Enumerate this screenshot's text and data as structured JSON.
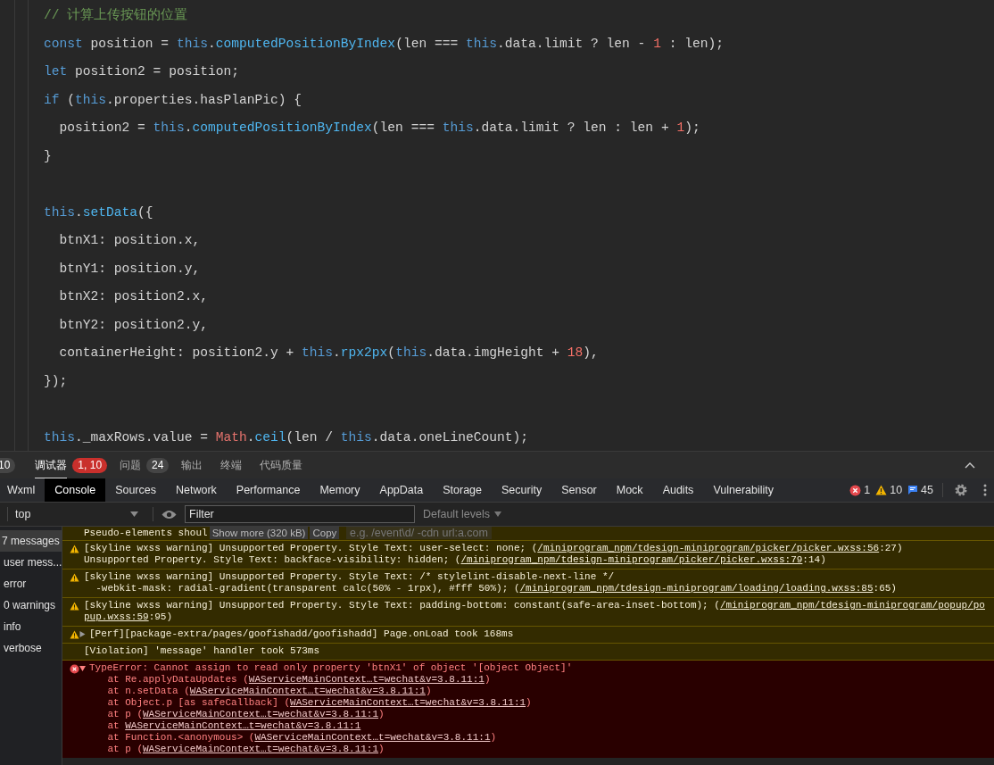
{
  "editor": {
    "lines": [
      {
        "kind": "code",
        "tokens": [
          {
            "t": "// 计算上传按钮的位置",
            "color": "#6a9955"
          }
        ]
      },
      {
        "kind": "code",
        "tokens": [
          {
            "t": "const",
            "color": "#569cd6"
          },
          {
            "t": " position = "
          },
          {
            "t": "this",
            "color": "#569cd6"
          },
          {
            "t": "."
          },
          {
            "t": "computedPositionByIndex",
            "color": "#4fb6f0"
          },
          {
            "t": "(len === "
          },
          {
            "t": "this",
            "color": "#569cd6"
          },
          {
            "t": ".data.limit ? len - "
          },
          {
            "t": "1",
            "color": "#f47067"
          },
          {
            "t": " : len);"
          }
        ]
      },
      {
        "kind": "code",
        "tokens": [
          {
            "t": "let",
            "color": "#569cd6"
          },
          {
            "t": " position2 = position;"
          }
        ]
      },
      {
        "kind": "code",
        "tokens": [
          {
            "t": "if",
            "color": "#569cd6"
          },
          {
            "t": " ("
          },
          {
            "t": "this",
            "color": "#569cd6"
          },
          {
            "t": ".properties.hasPlanPic) {"
          }
        ]
      },
      {
        "kind": "code",
        "tokens": [
          {
            "t": "  position2 = "
          },
          {
            "t": "this",
            "color": "#569cd6"
          },
          {
            "t": "."
          },
          {
            "t": "computedPositionByIndex",
            "color": "#4fb6f0"
          },
          {
            "t": "(len === "
          },
          {
            "t": "this",
            "color": "#569cd6"
          },
          {
            "t": ".data.limit ? len : len + "
          },
          {
            "t": "1",
            "color": "#f47067"
          },
          {
            "t": ");"
          }
        ]
      },
      {
        "kind": "code",
        "tokens": [
          {
            "t": "}"
          }
        ]
      },
      {
        "kind": "blank"
      },
      {
        "kind": "code",
        "tokens": [
          {
            "t": "this",
            "color": "#569cd6"
          },
          {
            "t": "."
          },
          {
            "t": "setData",
            "color": "#4fb6f0"
          },
          {
            "t": "({"
          }
        ]
      },
      {
        "kind": "code",
        "tokens": [
          {
            "t": "  btnX1: position.x,"
          }
        ]
      },
      {
        "kind": "code",
        "tokens": [
          {
            "t": "  btnY1: position.y,"
          }
        ]
      },
      {
        "kind": "code",
        "tokens": [
          {
            "t": "  btnX2: position2.x,"
          }
        ]
      },
      {
        "kind": "code",
        "tokens": [
          {
            "t": "  btnY2: position2.y,"
          }
        ]
      },
      {
        "kind": "code",
        "tokens": [
          {
            "t": "  containerHeight: position2.y + "
          },
          {
            "t": "this",
            "color": "#569cd6"
          },
          {
            "t": "."
          },
          {
            "t": "rpx2px",
            "color": "#4fb6f0"
          },
          {
            "t": "("
          },
          {
            "t": "this",
            "color": "#569cd6"
          },
          {
            "t": ".data.imgHeight + "
          },
          {
            "t": "18",
            "color": "#f47067"
          },
          {
            "t": "),"
          }
        ]
      },
      {
        "kind": "code",
        "tokens": [
          {
            "t": "});"
          }
        ]
      },
      {
        "kind": "blank"
      },
      {
        "kind": "code",
        "tokens": [
          {
            "t": "this",
            "color": "#569cd6"
          },
          {
            "t": "._maxRows.value = "
          },
          {
            "t": "Math",
            "color": "#e5736d"
          },
          {
            "t": "."
          },
          {
            "t": "ceil",
            "color": "#4fb6f0"
          },
          {
            "t": "(len / "
          },
          {
            "t": "this",
            "color": "#569cd6"
          },
          {
            "t": ".data.oneLineCount);"
          }
        ]
      }
    ]
  },
  "panel": {
    "cut_badge": "10",
    "tabs": [
      {
        "label": "调试器",
        "badge": {
          "text": "1, 10",
          "color": "#c9302c"
        },
        "selected": true
      },
      {
        "label": "问题",
        "badge": {
          "text": "24",
          "color": "#454545"
        },
        "selected": false
      },
      {
        "label": "输出",
        "selected": false
      },
      {
        "label": "终端",
        "selected": false
      },
      {
        "label": "代码质量",
        "selected": false
      }
    ]
  },
  "devtools_tabs": [
    {
      "label": "Wxml",
      "selected": false
    },
    {
      "label": "Console",
      "selected": true
    },
    {
      "label": "Sources",
      "selected": false
    },
    {
      "label": "Network",
      "selected": false
    },
    {
      "label": "Performance",
      "selected": false
    },
    {
      "label": "Memory",
      "selected": false
    },
    {
      "label": "AppData",
      "selected": false
    },
    {
      "label": "Storage",
      "selected": false
    },
    {
      "label": "Security",
      "selected": false
    },
    {
      "label": "Sensor",
      "selected": false
    },
    {
      "label": "Mock",
      "selected": false
    },
    {
      "label": "Audits",
      "selected": false
    },
    {
      "label": "Vulnerability",
      "selected": false
    }
  ],
  "counts": {
    "errors": "1",
    "warnings": "10",
    "messages": "45"
  },
  "toolbar": {
    "context": "top",
    "filter_placeholder": "Filter",
    "levels": "Default levels",
    "filter_hint": "e.g. /event\\d/ -cdn url:a.com"
  },
  "sidebar": [
    {
      "label": "7 messages",
      "selected": true
    },
    {
      "label": "user mess...",
      "selected": false
    },
    {
      "label": "error",
      "selected": false
    },
    {
      "label": "0 warnings",
      "selected": false
    },
    {
      "label": "info",
      "selected": false
    },
    {
      "label": "verbose",
      "selected": false
    }
  ],
  "messages": [
    {
      "kind": "truncated",
      "lines": [
        [
          "Pseudo-elements shoul"
        ]
      ],
      "buttons": [
        "Show more (320 kB)",
        "Copy"
      ]
    },
    {
      "kind": "warning",
      "lines": [
        [
          "[skyline wxss warning] Unsupported Property. Style Text: user-select: none; (",
          {
            "link": "/miniprogram_npm/tdesign-miniprogram/picker/picker.wxss:56"
          },
          ":27)"
        ],
        [
          "Unsupported Property. Style Text: backface-visibility: hidden; (",
          {
            "link": "/miniprogram_npm/tdesign-miniprogram/picker/picker.wxss:79"
          },
          ":14)"
        ]
      ]
    },
    {
      "kind": "warning",
      "lines": [
        [
          "[skyline wxss warning] Unsupported Property. Style Text: /* stylelint-disable-next-line */"
        ],
        [
          "  -webkit-mask: radial-gradient(transparent calc(50% - 1rpx), #fff 50%); (",
          {
            "link": "/miniprogram_npm/tdesign-miniprogram/loading/loading.wxss:85"
          },
          ":65)"
        ]
      ]
    },
    {
      "kind": "warning",
      "lines": [
        [
          "[skyline wxss warning] Unsupported Property. Style Text: padding-bottom: constant(safe-area-inset-bottom); (",
          {
            "link": "/miniprogram_npm/tdesign-miniprogram/popup/po"
          }
        ],
        [
          {
            "link": "pup.wxss:59"
          },
          ":95)"
        ]
      ]
    },
    {
      "kind": "warning",
      "expanded": false,
      "lines": [
        [
          "[Perf][package-extra/pages/goofishadd/goofishadd] Page.onLoad took 168ms"
        ]
      ]
    },
    {
      "kind": "violation",
      "lines": [
        [
          "[Violation] 'message' handler took 573ms"
        ]
      ]
    },
    {
      "kind": "error",
      "expanded": true,
      "lines": [
        [
          "TypeError: Cannot assign to read only property 'btnX1' of object '[object Object]'"
        ],
        [
          "    at Re.applyDataUpdates (",
          {
            "link": "WAServiceMainContext…t=wechat&v=3.8.11:1"
          },
          ")"
        ],
        [
          "    at n.setData (",
          {
            "link": "WAServiceMainContext…t=wechat&v=3.8.11:1"
          },
          ")"
        ],
        [
          "    at Object.p [as safeCallback] (",
          {
            "link": "WAServiceMainContext…t=wechat&v=3.8.11:1"
          },
          ")"
        ],
        [
          "    at p (",
          {
            "link": "WAServiceMainContext…t=wechat&v=3.8.11:1"
          },
          ")"
        ],
        [
          "    at ",
          {
            "link": "WAServiceMainContext…t=wechat&v=3.8.11:1"
          }
        ],
        [
          "    at Function.<anonymous> (",
          {
            "link": "WAServiceMainContext…t=wechat&v=3.8.11:1"
          },
          ")"
        ],
        [
          "    at p (",
          {
            "link": "WAServiceMainContext…t=wechat&v=3.8.11:1"
          },
          ")"
        ]
      ]
    }
  ]
}
